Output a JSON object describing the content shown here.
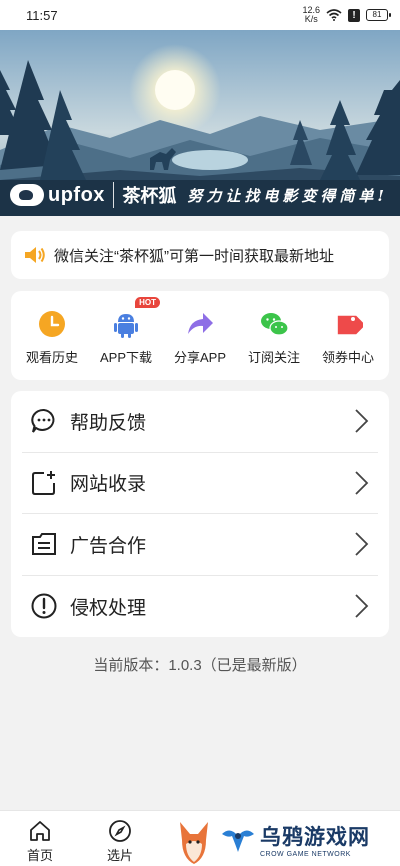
{
  "status_bar": {
    "time": "11:57",
    "net_speed_value": "12.6",
    "net_speed_unit": "K/s",
    "alert": "!",
    "battery": "81"
  },
  "banner": {
    "brand_en": "upfox",
    "brand_cn": "茶杯狐",
    "slogan": "努力让找电影变得简单!"
  },
  "notice": {
    "text": "微信关注“茶杯狐”可第一时间获取最新地址"
  },
  "actions": [
    {
      "label": "观看历史",
      "icon": "clock-icon",
      "color": "#f5a623"
    },
    {
      "label": "APP下载",
      "icon": "android-icon",
      "color": "#4a7fe0",
      "badge": "HOT"
    },
    {
      "label": "分享APP",
      "icon": "share-arrow-icon",
      "color": "#8e6ee6"
    },
    {
      "label": "订阅关注",
      "icon": "wechat-icon",
      "color": "#3cc44a"
    },
    {
      "label": "领券中心",
      "icon": "coupon-tag-icon",
      "color": "#ee4a4a"
    }
  ],
  "menu": [
    {
      "label": "帮助反馈",
      "icon": "chat-bubble-icon"
    },
    {
      "label": "网站收录",
      "icon": "add-page-icon"
    },
    {
      "label": "广告合作",
      "icon": "ad-document-icon"
    },
    {
      "label": "侵权处理",
      "icon": "alert-circle-icon"
    }
  ],
  "version": "当前版本：1.0.3（已是最新版）",
  "tabs": [
    {
      "label": "首页",
      "icon": "home-icon"
    },
    {
      "label": "选片",
      "icon": "compass-icon"
    }
  ],
  "watermark": {
    "cn": "乌鸦游戏网",
    "en": "CROW GAME NETWORK"
  }
}
